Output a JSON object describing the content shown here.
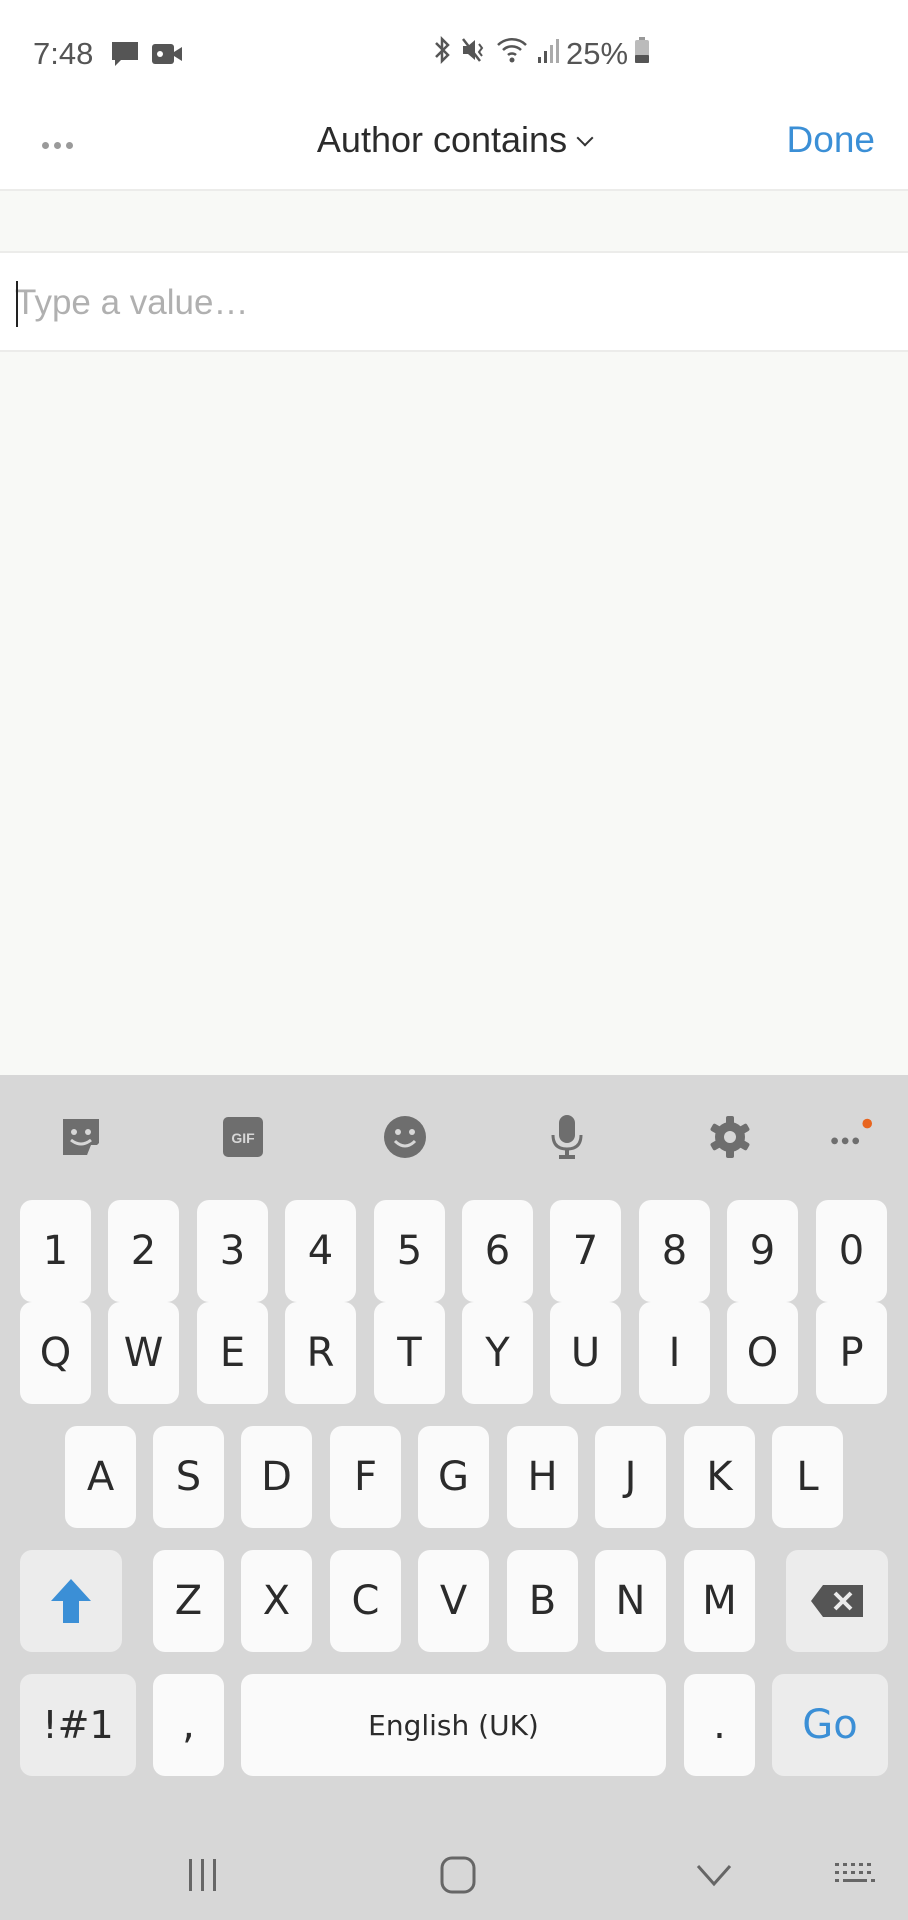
{
  "status_bar": {
    "time": "7:48",
    "left_icons": [
      "message-icon",
      "video-icon"
    ],
    "right_icons": [
      "bluetooth-icon",
      "mute-icon",
      "wifi-icon",
      "signal-icon"
    ],
    "battery": "25%"
  },
  "header": {
    "more_icon": "more-horizontal-icon",
    "title": "Author contains",
    "title_icon": "chevron-down-icon",
    "done_label": "Done",
    "accent_color": "#3b8fd6"
  },
  "input": {
    "value": "",
    "placeholder": "Type a value…"
  },
  "keyboard": {
    "toolbar": [
      "sticker-icon",
      "gif-icon",
      "emoji-icon",
      "microphone-icon",
      "settings-icon",
      "more-icon"
    ],
    "gif_label": "GIF",
    "numbers": [
      "1",
      "2",
      "3",
      "4",
      "5",
      "6",
      "7",
      "8",
      "9",
      "0"
    ],
    "row1": [
      "Q",
      "W",
      "E",
      "R",
      "T",
      "Y",
      "U",
      "I",
      "O",
      "P"
    ],
    "row2": [
      "A",
      "S",
      "D",
      "F",
      "G",
      "H",
      "J",
      "K",
      "L"
    ],
    "row3": [
      "Z",
      "X",
      "C",
      "V",
      "B",
      "N",
      "M"
    ],
    "symbols_label": "!#1",
    "comma": ",",
    "space_label": "English (UK)",
    "period": ".",
    "go_label": "Go",
    "go_color": "#3b8fd6",
    "shift_color": "#3b8fd6"
  },
  "nav_bar": [
    "recents-icon",
    "home-icon",
    "back-icon",
    "keyboard-switch-icon"
  ]
}
